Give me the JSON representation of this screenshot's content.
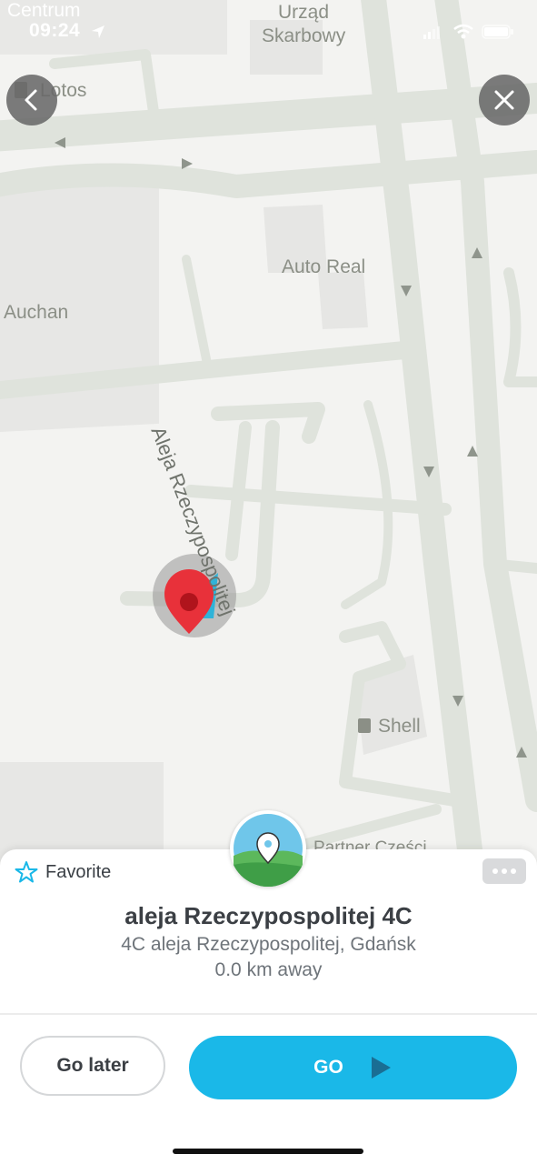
{
  "status_bar": {
    "carrier": "Centrum",
    "time": "09:24"
  },
  "map": {
    "labels": {
      "urzad_line1": "Urząd",
      "urzad_line2": "Skarbowy",
      "lotos": "Lotos",
      "auto_real": "Auto Real",
      "auchan": "Auchan",
      "shell": "Shell",
      "partner": "Partner Części"
    },
    "street_name": "Aleja Rzeczypospolitej"
  },
  "sheet": {
    "favorite_label": "Favorite",
    "title": "aleja Rzeczypospolitej 4C",
    "address": "4C aleja Rzeczypospolitej, Gdańsk",
    "distance": "0.0 km away",
    "go_later_label": "Go later",
    "go_label": "GO"
  },
  "icons": {
    "back": "chevron-left-icon",
    "close": "close-icon",
    "favorite": "star-icon",
    "more": "more-icon",
    "pin": "map-pin-icon",
    "play": "play-icon"
  },
  "colors": {
    "go_button": "#1ab8e8",
    "pin": "#e8313a"
  }
}
